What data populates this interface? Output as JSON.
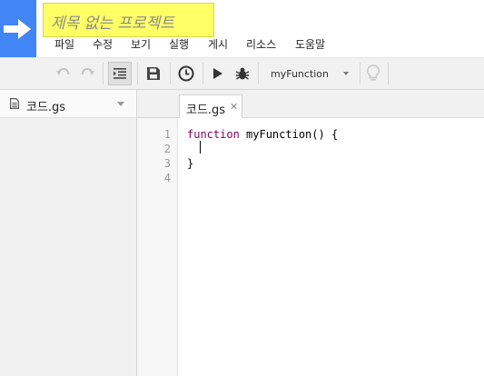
{
  "header": {
    "title": "제목 없는 프로젝트",
    "menu": [
      "파일",
      "수정",
      "보기",
      "실행",
      "게시",
      "리소스",
      "도움말"
    ]
  },
  "toolbar": {
    "buttons": [
      "undo-icon",
      "redo-icon",
      "indent-icon",
      "save-icon",
      "triggers-clock-icon",
      "run-icon",
      "debug-bug-icon",
      "lightbulb-icon"
    ],
    "function_select": "myFunction"
  },
  "sidebar": {
    "files": [
      {
        "name": "코드.gs",
        "icon": "document-icon"
      }
    ]
  },
  "editor": {
    "tab_label": "코드.gs",
    "line_numbers": [
      "1",
      "2",
      "3",
      "4"
    ],
    "code": {
      "line1_keyword": "function",
      "line1_rest": " myFunction() {",
      "line3": "}"
    }
  },
  "colors": {
    "logo_blue": "#4285f4",
    "title_highlight": "#ffff66",
    "keyword": "#7f0055"
  }
}
